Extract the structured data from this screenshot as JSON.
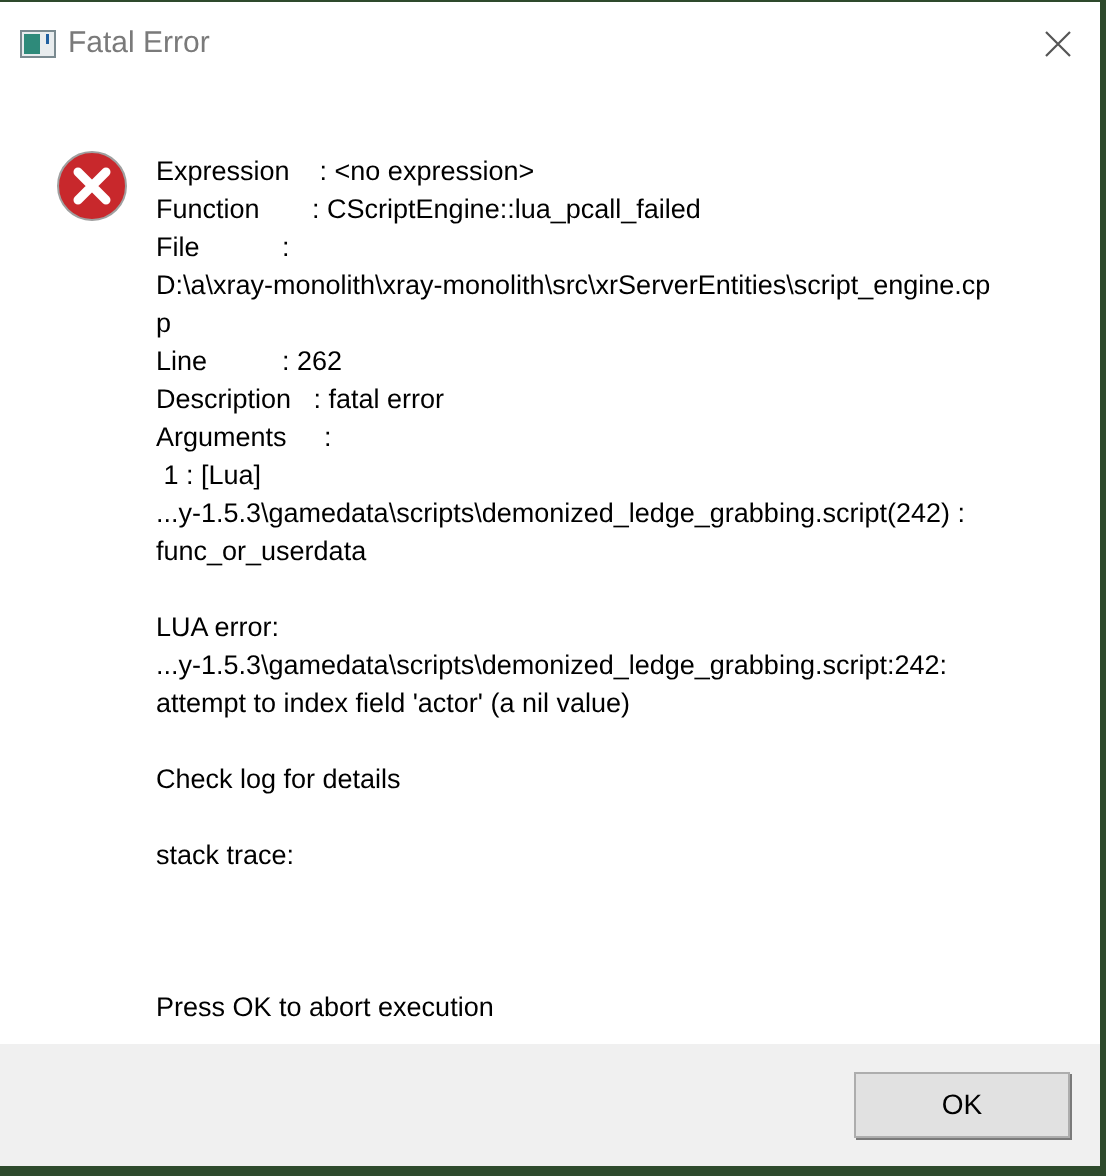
{
  "window": {
    "title": "Fatal Error"
  },
  "message": [
    {
      "lines": [
        "Expression    : <no expression>",
        "Function       : CScriptEngine::lua_pcall_failed",
        "File           :",
        "D:\\a\\xray-monolith\\xray-monolith\\src\\xrServerEntities\\script_engine.cp",
        "p",
        "Line          : 262",
        "Description   : fatal error",
        "Arguments     :",
        " 1 : [Lua]",
        "...y-1.5.3\\gamedata\\scripts\\demonized_ledge_grabbing.script(242) :",
        "func_or_userdata"
      ]
    },
    {
      "lines": [
        "LUA error:",
        "...y-1.5.3\\gamedata\\scripts\\demonized_ledge_grabbing.script:242:",
        "attempt to index field 'actor' (a nil value)"
      ]
    },
    {
      "lines": [
        "Check log for details"
      ]
    },
    {
      "lines": [
        "stack trace:"
      ]
    },
    {
      "lines": [
        "Press OK to abort execution"
      ]
    }
  ],
  "buttons": [
    "OK"
  ]
}
